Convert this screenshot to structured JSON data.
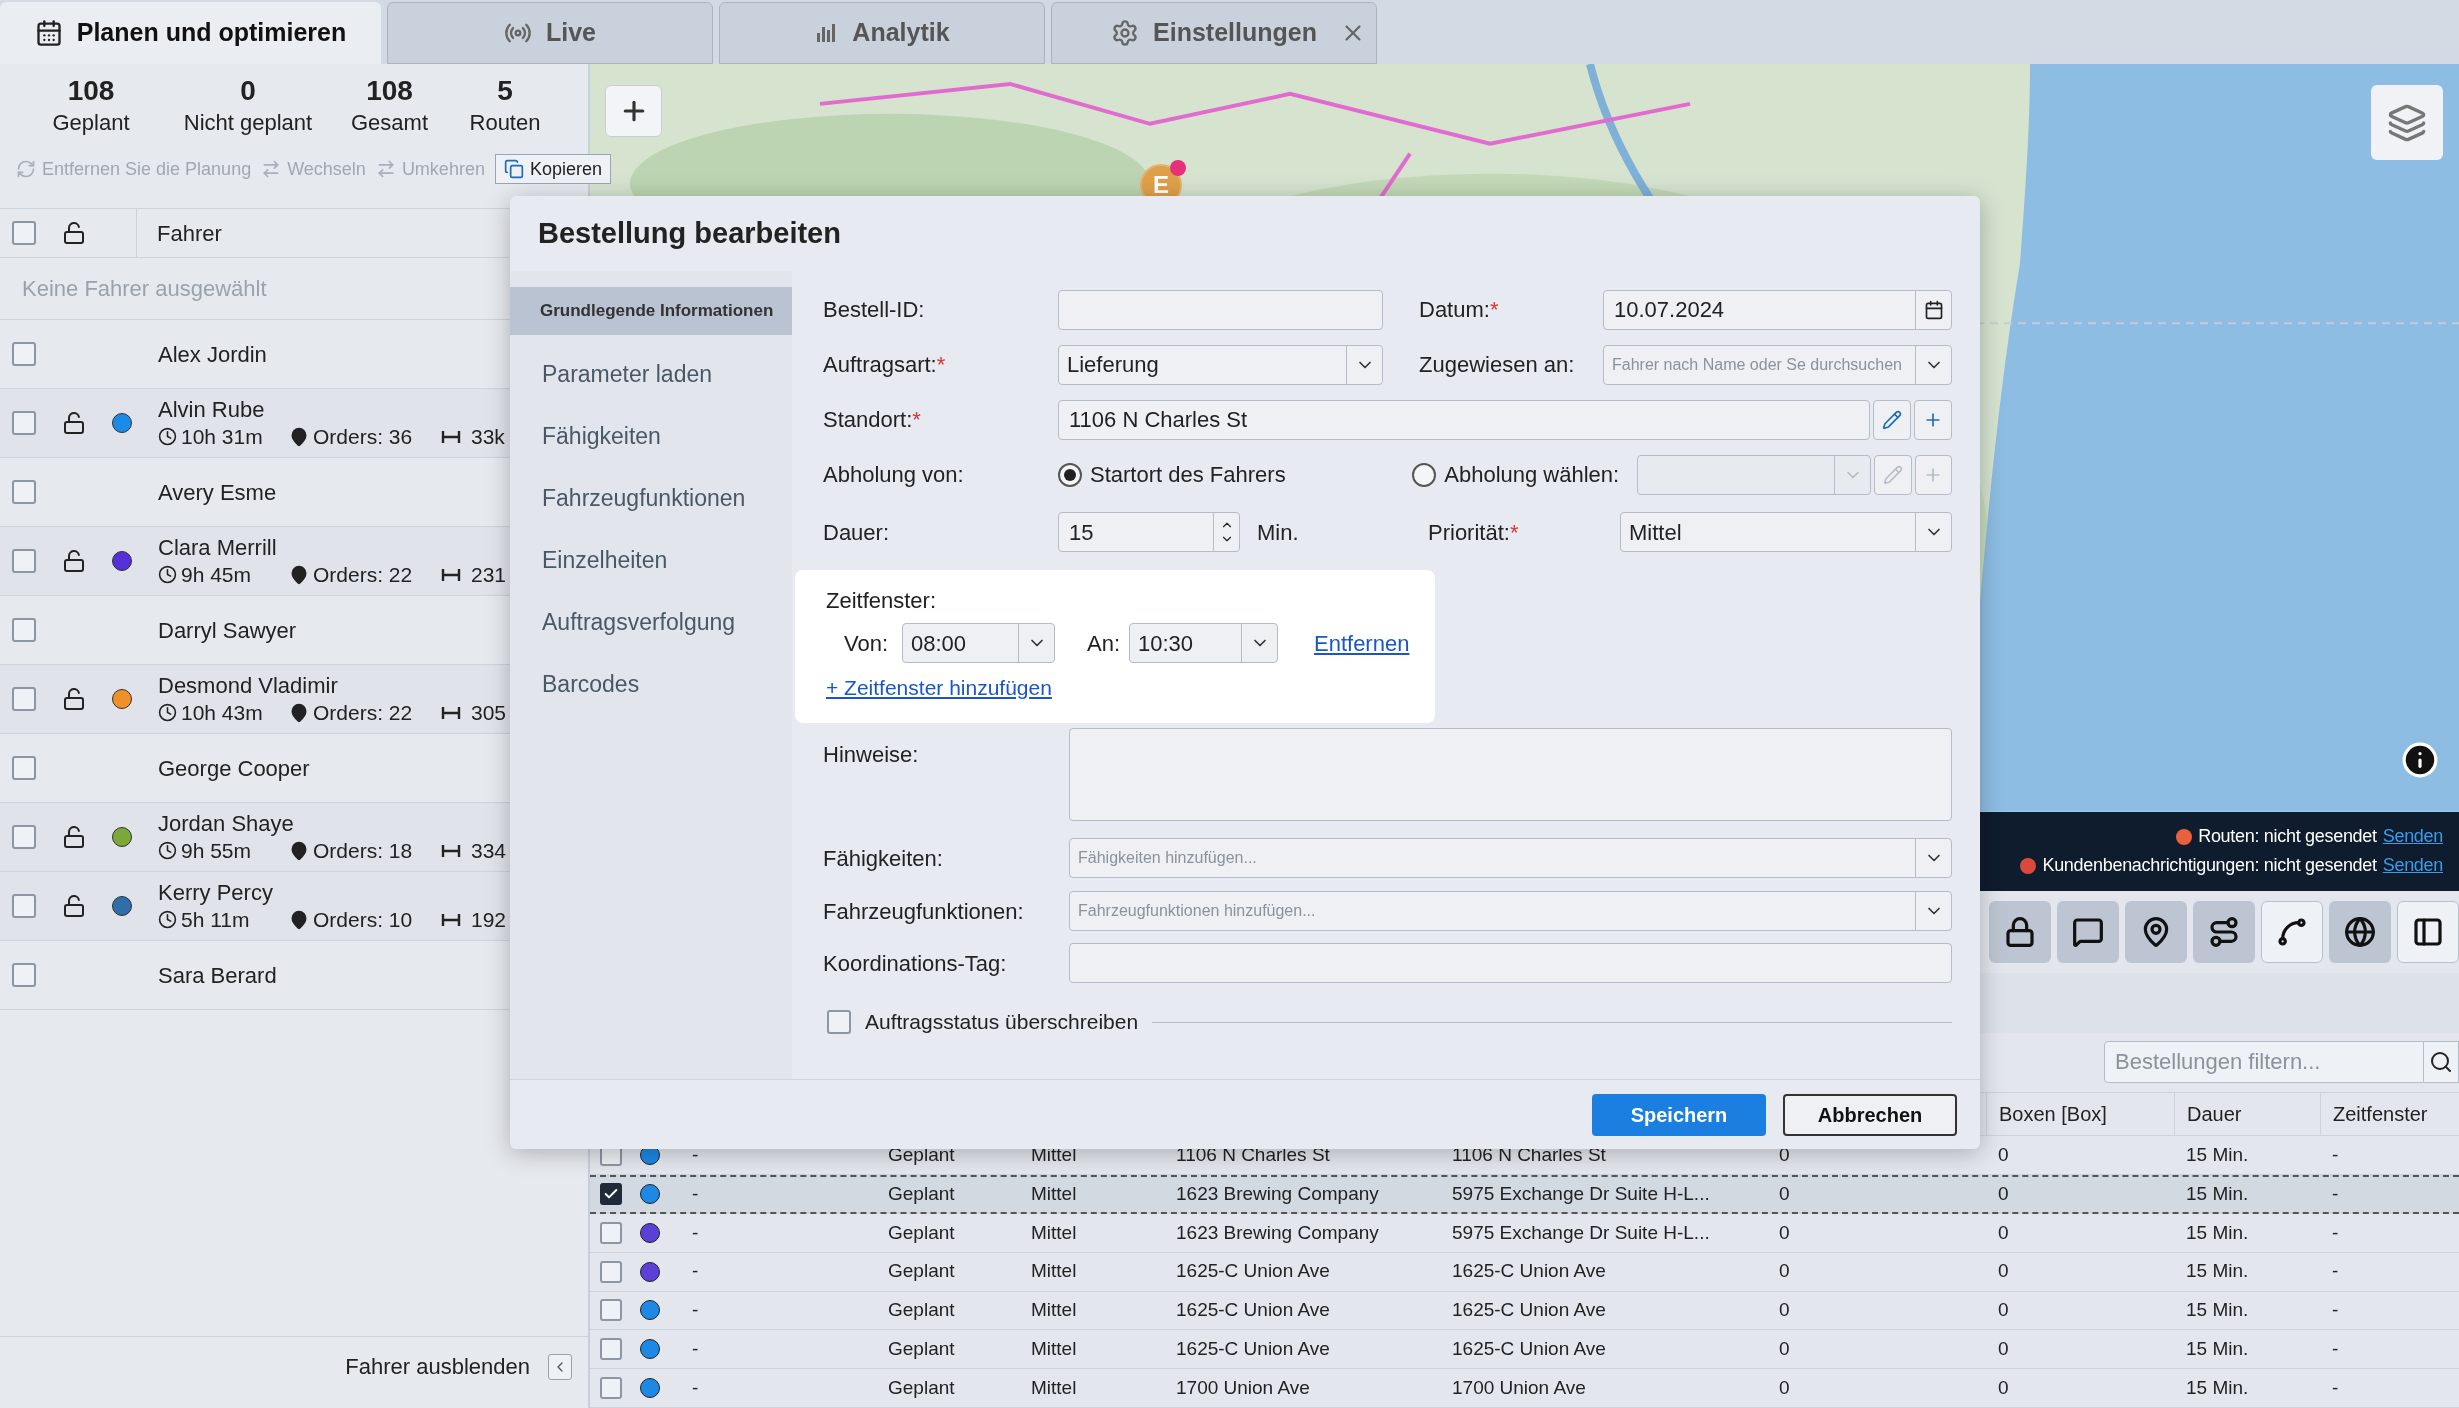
{
  "tabs": [
    {
      "label": "Planen und optimieren",
      "selected": true,
      "closable": false
    },
    {
      "label": "Live",
      "selected": false,
      "closable": false
    },
    {
      "label": "Analytik",
      "selected": false,
      "closable": false
    },
    {
      "label": "Einstellungen",
      "selected": false,
      "closable": true
    }
  ],
  "stats": [
    {
      "value": "108",
      "label": "Geplant"
    },
    {
      "value": "0",
      "label": "Nicht geplant"
    },
    {
      "value": "108",
      "label": "Gesamt"
    },
    {
      "value": "5",
      "label": "Routen"
    }
  ],
  "actions": [
    {
      "label": "Entfernen Sie die Planung",
      "disabled": true
    },
    {
      "label": "Wechseln",
      "disabled": true
    },
    {
      "label": "Umkehren",
      "disabled": true
    },
    {
      "label": "Kopieren",
      "disabled": false
    }
  ],
  "drivers": {
    "header": {
      "checked": false,
      "column": "Fahrer"
    },
    "empty_note": "Keine Fahrer ausgewählt",
    "rows": [
      {
        "name": "Alex Jordin",
        "checked": false
      },
      {
        "name": "Alvin Rube",
        "checked": false,
        "color": "#1a8ce8",
        "time": "10h 31m",
        "orders": "Orders: 36",
        "distance": "33k"
      },
      {
        "name": "Avery Esme",
        "checked": false
      },
      {
        "name": "Clara Merrill",
        "checked": false,
        "color": "#5530d8",
        "time": "9h 45m",
        "orders": "Orders: 22",
        "distance": "231"
      },
      {
        "name": "Darryl Sawyer",
        "checked": false
      },
      {
        "name": "Desmond Vladimir",
        "checked": false,
        "color": "#f0902a",
        "time": "10h 43m",
        "orders": "Orders: 22",
        "distance": "305"
      },
      {
        "name": "George Cooper",
        "checked": false
      },
      {
        "name": "Jordan Shaye",
        "checked": false,
        "color": "#7ca83a",
        "time": "9h 55m",
        "orders": "Orders: 18",
        "distance": "334"
      },
      {
        "name": "Kerry Percy",
        "checked": false,
        "color": "#2f6ea8",
        "time": "5h 11m",
        "orders": "Orders: 10",
        "distance": "192"
      },
      {
        "name": "Sara Berard",
        "checked": false
      }
    ],
    "hide_label": "Fahrer ausblenden"
  },
  "map": {
    "marker": "E"
  },
  "status": [
    {
      "label": "Routen:",
      "value": "nicht gesendet",
      "link": "Senden",
      "color": "#e8603c"
    },
    {
      "label": "Kundenbenachrichtigungen:",
      "value": "nicht gesendet",
      "link": "Senden",
      "color": "#d94a3c"
    }
  ],
  "map_tools": [
    {
      "on": true
    },
    {
      "on": true
    },
    {
      "on": true
    },
    {
      "on": true
    },
    {
      "on": false
    },
    {
      "on": true
    },
    {
      "on": false
    }
  ],
  "filter": {
    "placeholder": "Bestellungen filtern..."
  },
  "table": {
    "columns": [
      "",
      "",
      "",
      "",
      "",
      "",
      "Boxen [Box]",
      "Dauer",
      "Zeitfenster"
    ],
    "rows": [
      {
        "checked": false,
        "selected": false,
        "color": "#1e88e5",
        "cells": [
          "-",
          "Geplant",
          "Mittel",
          "1106 N Charles St",
          "1106 N Charles St",
          "0",
          "0",
          "15 Min.",
          "-"
        ]
      },
      {
        "checked": true,
        "selected": true,
        "color": "#1e88e5",
        "cells": [
          "-",
          "Geplant",
          "Mittel",
          "1623 Brewing Company",
          "5975 Exchange Dr Suite H-L...",
          "0",
          "0",
          "15 Min.",
          "-"
        ]
      },
      {
        "checked": false,
        "selected": false,
        "color": "#5b3fd6",
        "cells": [
          "-",
          "Geplant",
          "Mittel",
          "1623 Brewing Company",
          "5975 Exchange Dr Suite H-L...",
          "0",
          "0",
          "15 Min.",
          "-"
        ]
      },
      {
        "checked": false,
        "selected": false,
        "color": "#5b3fd6",
        "cells": [
          "-",
          "Geplant",
          "Mittel",
          "1625-C Union Ave",
          "1625-C Union Ave",
          "0",
          "0",
          "15 Min.",
          "-"
        ]
      },
      {
        "checked": false,
        "selected": false,
        "color": "#1e88e5",
        "cells": [
          "-",
          "Geplant",
          "Mittel",
          "1625-C Union Ave",
          "1625-C Union Ave",
          "0",
          "0",
          "15 Min.",
          "-"
        ]
      },
      {
        "checked": false,
        "selected": false,
        "color": "#1e88e5",
        "cells": [
          "-",
          "Geplant",
          "Mittel",
          "1625-C Union Ave",
          "1625-C Union Ave",
          "0",
          "0",
          "15 Min.",
          "-"
        ]
      },
      {
        "checked": false,
        "selected": false,
        "color": "#1e88e5",
        "cells": [
          "-",
          "Geplant",
          "Mittel",
          "1700 Union Ave",
          "1700 Union Ave",
          "0",
          "0",
          "15 Min.",
          "-"
        ]
      }
    ]
  },
  "dialog": {
    "title": "Bestellung bearbeiten",
    "nav": [
      {
        "label": "Grundlegende Informationen",
        "selected": true
      },
      {
        "label": "Parameter laden",
        "selected": false
      },
      {
        "label": "Fähigkeiten",
        "selected": false
      },
      {
        "label": "Fahrzeugfunktionen",
        "selected": false
      },
      {
        "label": "Einzelheiten",
        "selected": false
      },
      {
        "label": "Auftragsverfolgung",
        "selected": false
      },
      {
        "label": "Barcodes",
        "selected": false
      }
    ],
    "order_id": {
      "label": "Bestell-ID:"
    },
    "date": {
      "label": "Datum:",
      "mark": "*",
      "value": "10.07.2024"
    },
    "order_type": {
      "label": "Auftragsart:",
      "mark": "*",
      "value": "Lieferung"
    },
    "assigned_to": {
      "label": "Zugewiesen an:",
      "placeholder": "Fahrer nach Name oder Se durchsuchen"
    },
    "location": {
      "label": "Standort:",
      "mark": "*",
      "value": "1106 N Charles St"
    },
    "pickup": {
      "label": "Abholung von:",
      "options": [
        {
          "label": "Startort des Fahrers",
          "selected": true
        },
        {
          "label": "Abholung wählen:",
          "selected": false
        }
      ]
    },
    "duration": {
      "label": "Dauer:",
      "value": "15",
      "unit": "Min."
    },
    "priority": {
      "label": "Priorität:",
      "mark": "*",
      "value": "Mittel"
    },
    "time_window": {
      "label": "Zeitfenster:",
      "from_label": "Von:",
      "from": "08:00",
      "to_label": "An:",
      "to": "10:30",
      "remove": "Entfernen",
      "add": "+ Zeitfenster hinzufügen"
    },
    "notes": {
      "label": "Hinweise:"
    },
    "skills": {
      "label": "Fähigkeiten:",
      "placeholder": "Fähigkeiten hinzufügen..."
    },
    "vehicle": {
      "label": "Fahrzeugfunktionen:",
      "placeholder": "Fahrzeugfunktionen hinzufügen..."
    },
    "coord_tag": {
      "label": "Koordinations-Tag:"
    },
    "override": {
      "label": "Auftragsstatus überschreiben",
      "checked": false
    },
    "buttons": [
      {
        "label": "Speichern",
        "kind": "primary"
      },
      {
        "label": "Abbrechen",
        "kind": "secondary"
      }
    ]
  }
}
